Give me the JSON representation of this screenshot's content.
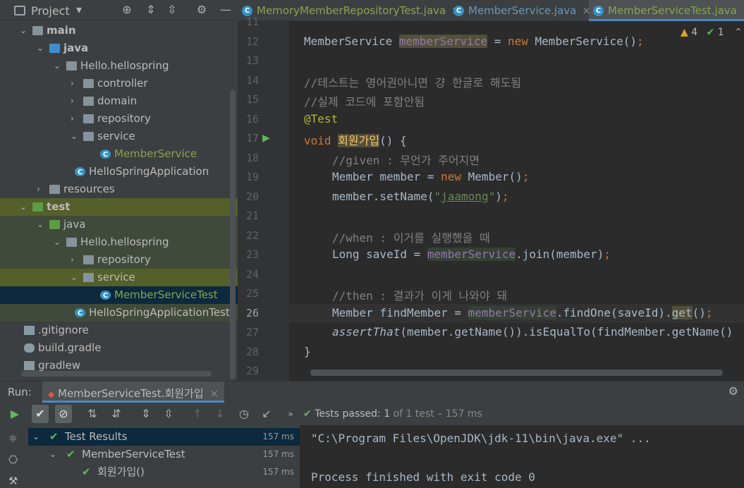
{
  "project_panel": {
    "title": "Project",
    "tree": [
      {
        "label": "main",
        "depth": 1,
        "kind": "folder",
        "expanded": true
      },
      {
        "label": "java",
        "depth": 2,
        "kind": "src",
        "expanded": true
      },
      {
        "label": "Hello.hellospring",
        "depth": 3,
        "kind": "package",
        "expanded": true
      },
      {
        "label": "controller",
        "depth": 4,
        "kind": "package",
        "expanded": false
      },
      {
        "label": "domain",
        "depth": 4,
        "kind": "package",
        "expanded": false
      },
      {
        "label": "repository",
        "depth": 4,
        "kind": "package",
        "expanded": false
      },
      {
        "label": "service",
        "depth": 4,
        "kind": "package",
        "expanded": true
      },
      {
        "label": "MemberService",
        "depth": 5,
        "kind": "class"
      },
      {
        "label": "HelloSpringApplication",
        "depth": 4,
        "kind": "appclass"
      },
      {
        "label": "resources",
        "depth": 2,
        "kind": "folder",
        "expanded": false
      },
      {
        "label": "test",
        "depth": 1,
        "kind": "testfolder",
        "expanded": true
      },
      {
        "label": "java",
        "depth": 2,
        "kind": "testsrc",
        "expanded": true
      },
      {
        "label": "Hello.hellospring",
        "depth": 3,
        "kind": "package",
        "expanded": true
      },
      {
        "label": "repository",
        "depth": 4,
        "kind": "package",
        "expanded": false
      },
      {
        "label": "service",
        "depth": 4,
        "kind": "package",
        "expanded": true
      },
      {
        "label": "MemberServiceTest",
        "depth": 5,
        "kind": "testclass"
      },
      {
        "label": "HelloSpringApplicationTests",
        "depth": 4,
        "kind": "apptest"
      },
      {
        "label": ".gitignore",
        "depth": 1,
        "kind": "file"
      },
      {
        "label": "build.gradle",
        "depth": 1,
        "kind": "gradle"
      },
      {
        "label": "gradlew",
        "depth": 1,
        "kind": "file"
      }
    ]
  },
  "editor": {
    "tabs": [
      {
        "label": "MemoryMemberRepositoryTest.java"
      },
      {
        "label": "MemberService.java"
      },
      {
        "label": "MemberServiceTest.java"
      }
    ],
    "warnings_count": "4",
    "ok_count": "1",
    "line_numbers": [
      "11",
      "12",
      "13",
      "14",
      "15",
      "16",
      "17",
      "18",
      "19",
      "20",
      "21",
      "22",
      "23",
      "24",
      "25",
      "26",
      "27",
      "28",
      "29"
    ],
    "current_line": "26"
  },
  "run_panel": {
    "label": "Run:",
    "tab": "MemberServiceTest.회원가입",
    "status_prefix": "Tests passed:",
    "status_count": "1",
    "status_suffix": "of 1 test – 157 ms",
    "results": [
      {
        "label": "Test Results",
        "time": "157 ms"
      },
      {
        "label": "MemberServiceTest",
        "time": "157 ms"
      },
      {
        "label": "회원가입()",
        "time": "157 ms"
      }
    ],
    "console": [
      "\"C:\\Program Files\\OpenJDK\\jdk-11\\bin\\java.exe\" ...",
      "",
      "Process finished with exit code 0"
    ]
  },
  "colors": {
    "accent": "#4a88c7",
    "pass": "#5fb85f",
    "keyword": "#cc7832"
  }
}
